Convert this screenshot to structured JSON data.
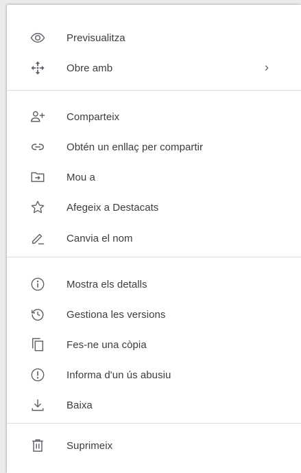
{
  "menu": {
    "items": [
      {
        "label": "Previsualitza",
        "icon": "eye-icon"
      },
      {
        "label": "Obre amb",
        "icon": "move-arrows-icon",
        "submenu_indicator": "›"
      },
      {
        "label": "Comparteix",
        "icon": "person-add-icon"
      },
      {
        "label": "Obtén un enllaç per compartir",
        "icon": "link-icon"
      },
      {
        "label": "Mou a",
        "icon": "folder-move-icon"
      },
      {
        "label": "Afegeix a Destacats",
        "icon": "star-icon"
      },
      {
        "label": "Canvia el nom",
        "icon": "pencil-icon"
      },
      {
        "label": "Mostra els detalls",
        "icon": "info-icon"
      },
      {
        "label": "Gestiona les versions",
        "icon": "history-icon"
      },
      {
        "label": "Fes-ne una còpia",
        "icon": "copy-icon"
      },
      {
        "label": "Informa d'un ús abusiu",
        "icon": "report-icon"
      },
      {
        "label": "Baixa",
        "icon": "download-icon"
      },
      {
        "label": "Suprimeix",
        "icon": "trash-icon"
      }
    ]
  },
  "colors": {
    "icon": "#5f6368",
    "text": "#3c3c3c",
    "divider": "#dcdcdc",
    "background": "#ffffff"
  }
}
